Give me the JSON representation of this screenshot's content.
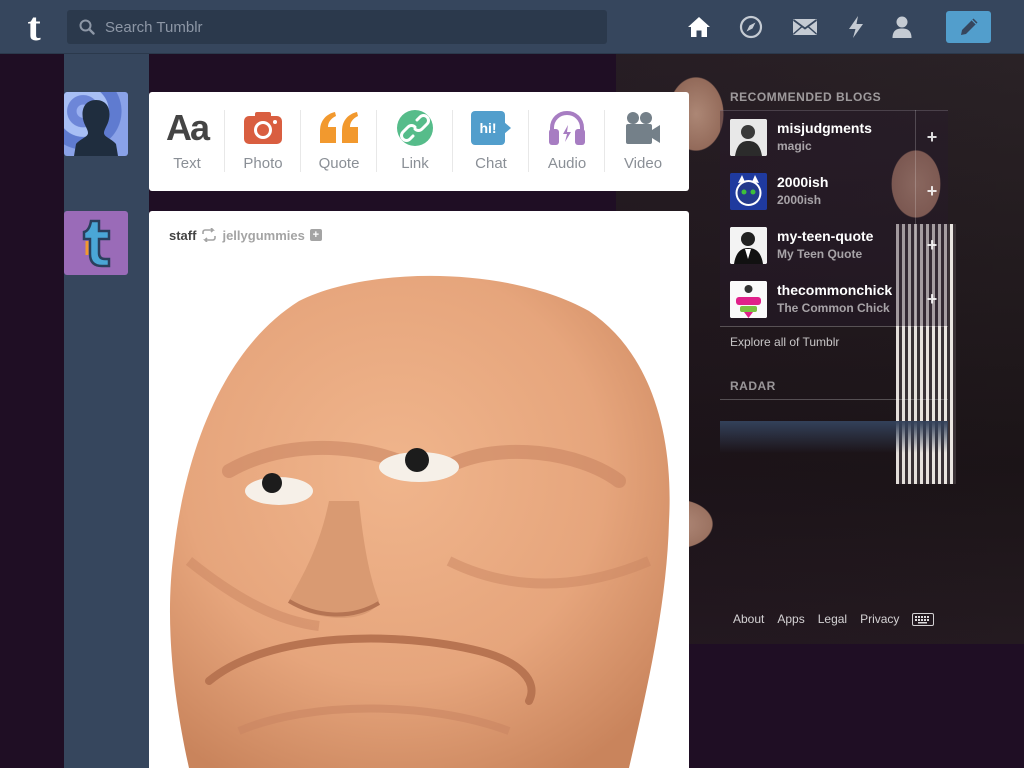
{
  "header": {
    "logo": "t",
    "search_placeholder": "Search Tumblr",
    "nav_icons": [
      "home-icon",
      "explore-compass-icon",
      "inbox-mail-icon",
      "activity-lightning-icon",
      "account-person-icon"
    ],
    "compose_icon": "pencil-icon"
  },
  "post_types": [
    {
      "label": "Text",
      "icon": "text-icon",
      "glyph": "Aa",
      "color": "#444444"
    },
    {
      "label": "Photo",
      "icon": "camera-icon",
      "color": "#d95e40"
    },
    {
      "label": "Quote",
      "icon": "quote-icon",
      "glyph": "“",
      "color": "#f2992e"
    },
    {
      "label": "Link",
      "icon": "link-icon",
      "color": "#56bc8a"
    },
    {
      "label": "Chat",
      "icon": "chat-icon",
      "glyph": "hi!",
      "color": "#529ecc"
    },
    {
      "label": "Audio",
      "icon": "headphones-icon",
      "color": "#a77dc2"
    },
    {
      "label": "Video",
      "icon": "video-camera-icon",
      "color": "#748089"
    }
  ],
  "post": {
    "author": "staff",
    "reblogged_from": "jellygummies",
    "follow_glyph": "+"
  },
  "sidebar": {
    "recommended_title": "RECOMMENDED BLOGS",
    "blogs": [
      {
        "name": "misjudgments",
        "subtitle": "magic"
      },
      {
        "name": "2000ish",
        "subtitle": "2000ish"
      },
      {
        "name": "my-teen-quote",
        "subtitle": "My Teen Quote"
      },
      {
        "name": "thecommonchick",
        "subtitle": "The Common Chick"
      }
    ],
    "follow_glyph": "+",
    "explore_link": "Explore all of Tumblr",
    "radar_title": "RADAR"
  },
  "footer": {
    "links": [
      "About",
      "Apps",
      "Legal",
      "Privacy"
    ],
    "keyboard_icon": "keyboard-icon"
  }
}
